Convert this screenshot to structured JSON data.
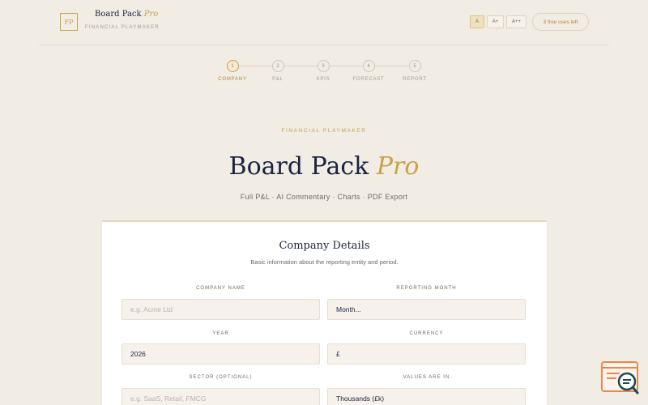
{
  "header": {
    "logo_initials": "FP",
    "brand_name": "Board Pack",
    "brand_pro": "Pro",
    "brand_sub": "FINANCIAL PLAYMAKER",
    "font_sizes": [
      {
        "label": "A",
        "active": true
      },
      {
        "label": "A+",
        "active": false
      },
      {
        "label": "A++",
        "active": false
      }
    ],
    "uses_badge": "3 free uses left"
  },
  "stepper": {
    "steps": [
      {
        "number": "1",
        "label": "COMPANY",
        "active": true
      },
      {
        "number": "2",
        "label": "P&L",
        "active": false
      },
      {
        "number": "3",
        "label": "KPIS",
        "active": false
      },
      {
        "number": "4",
        "label": "FORECAST",
        "active": false
      },
      {
        "number": "5",
        "label": "REPORT",
        "active": false
      }
    ]
  },
  "hero": {
    "eyebrow": "FINANCIAL PLAYMAKER",
    "title": "Board Pack",
    "title_pro": "Pro",
    "subtitle": "Full P&L · AI Commentary · Charts · PDF Export"
  },
  "form": {
    "title": "Company Details",
    "subtitle": "Basic information about the reporting entity and period.",
    "fields": {
      "company_name": {
        "label": "COMPANY NAME",
        "value": "",
        "placeholder": "e.g. Acme Ltd"
      },
      "reporting_month": {
        "label": "REPORTING MONTH",
        "value": "Month..."
      },
      "year": {
        "label": "YEAR",
        "value": "2026"
      },
      "currency": {
        "label": "CURRENCY",
        "value": "£"
      },
      "sector": {
        "label": "SECTOR (OPTIONAL)",
        "value": "",
        "placeholder": "e.g. SaaS, Retail, FMCG"
      },
      "values_in": {
        "label": "VALUES ARE IN",
        "value": "Thousands (£k)"
      }
    }
  },
  "colors": {
    "background": "#f1ece4",
    "accent_gold": "#c9a24a",
    "navy": "#1c2340",
    "widget_orange": "#e8894a"
  },
  "widget": {
    "icon": "search-chat-icon"
  }
}
